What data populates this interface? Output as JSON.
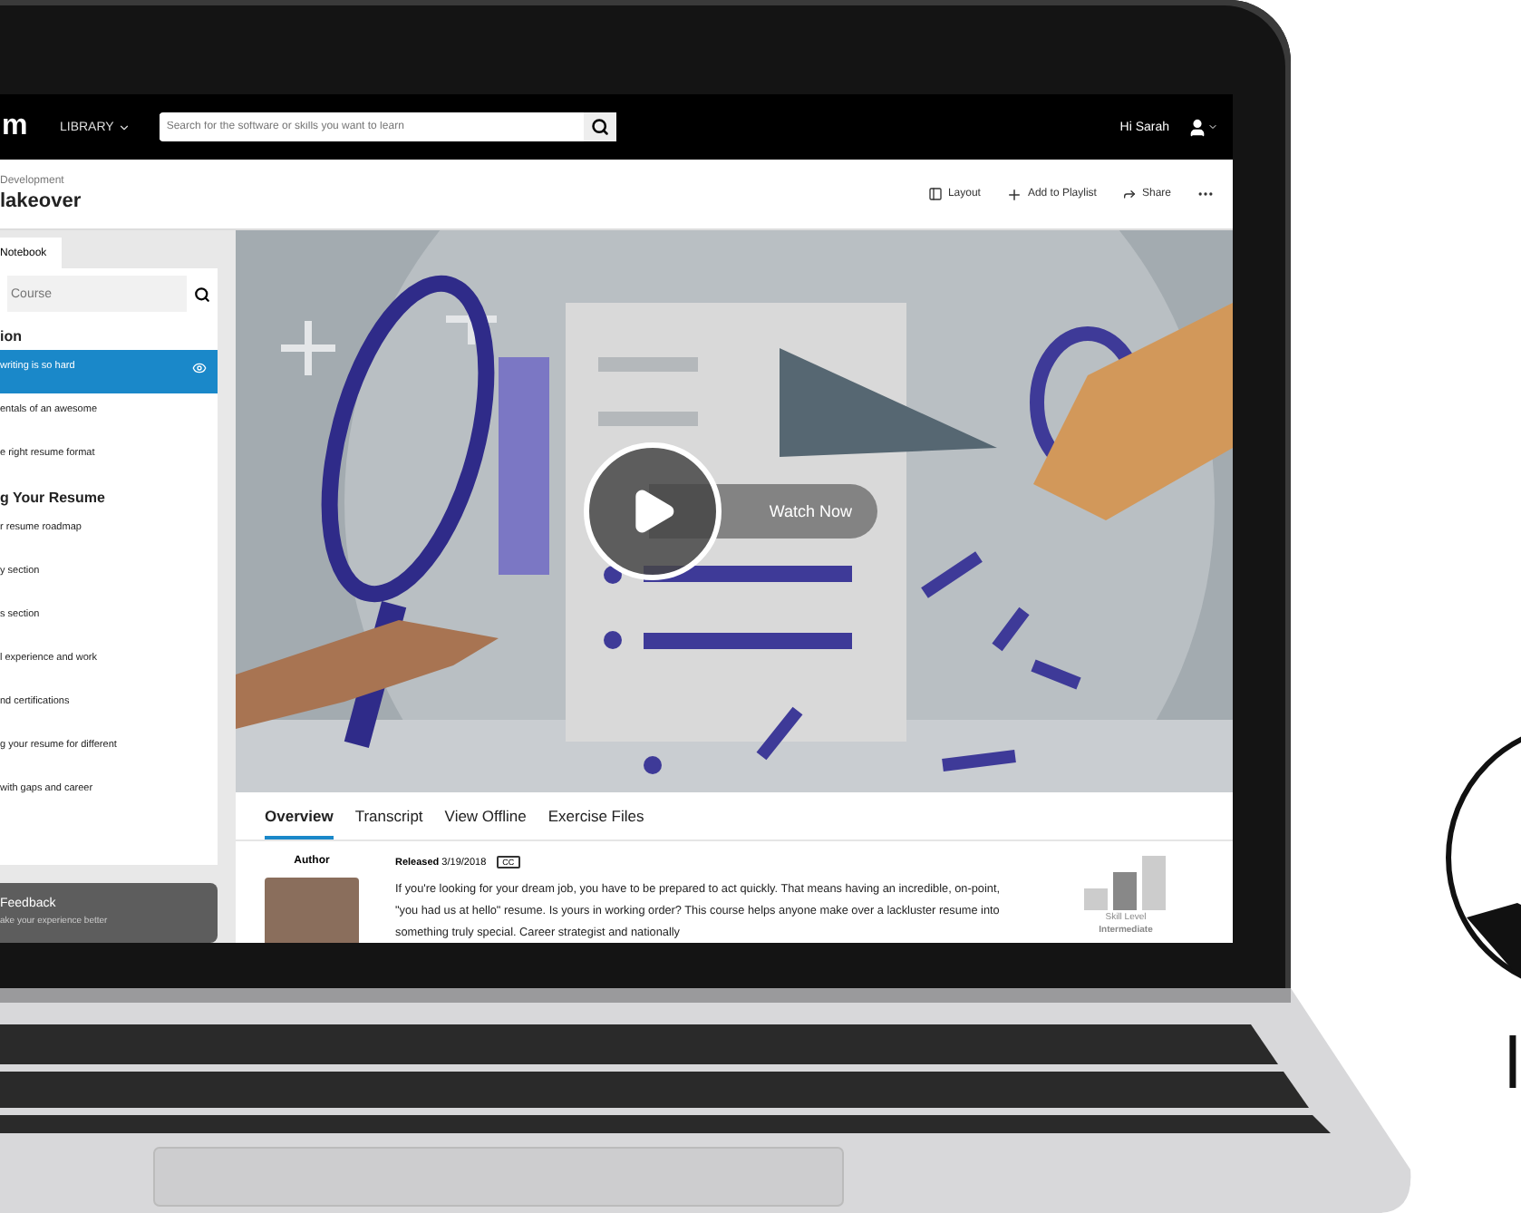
{
  "topbar": {
    "logo": "m",
    "library": "LIBRARY",
    "search": {
      "placeholder": "Search for the software or skills you want to learn"
    },
    "greeting": "Hi Sarah"
  },
  "header": {
    "breadcrumb": "Development",
    "title": "lakeover",
    "actions": [
      {
        "kind": "layout",
        "label": "Layout"
      },
      {
        "kind": "add",
        "label": "Add to Playlist"
      },
      {
        "kind": "share",
        "label": "Share"
      },
      {
        "kind": "more"
      }
    ]
  },
  "sidebar": {
    "tabs": [
      {
        "label": "Notebook",
        "selected": true
      }
    ],
    "search": {
      "placeholder": "Course"
    },
    "sections": [
      {
        "title": "ion",
        "items": [
          {
            "label": "writing is so hard",
            "selected": true
          },
          {
            "label": "entals of an awesome",
            "selected": false
          },
          {
            "label": "e right resume format",
            "selected": false
          }
        ]
      },
      {
        "title": "g Your Resume",
        "items": [
          {
            "label": "r resume roadmap",
            "selected": false
          },
          {
            "label": "y section",
            "selected": false
          },
          {
            "label": "s section",
            "selected": false
          },
          {
            "label": "l experience and work",
            "selected": false
          },
          {
            "label": "nd certifications",
            "selected": false
          },
          {
            "label": "g your resume for different",
            "selected": false
          },
          {
            "label": "with gaps and career",
            "selected": false
          }
        ]
      }
    ],
    "feedback": {
      "title": "Feedback",
      "text": "ake your experience better"
    }
  },
  "video": {
    "action": "Watch Now"
  },
  "tabs": [
    {
      "label": "Overview",
      "selected": true
    },
    {
      "label": "Transcript",
      "selected": false
    },
    {
      "label": "View Offline",
      "selected": false
    },
    {
      "label": "Exercise Files",
      "selected": false
    }
  ],
  "overview": {
    "author_label": "Author",
    "released": "**Released** 3/19/2018",
    "cc": "CC",
    "description": "If you're looking for your dream job, you have to be prepared to act quickly. That means having an incredible, on-point, \"you had us at hello\" resume. Is yours in working order? This course helps anyone make over a lackluster resume into something truly special. Career strategist and nationally",
    "skill": {
      "label": "Skill Level",
      "value": "Intermediate"
    }
  },
  "brand": {
    "text": "l"
  }
}
